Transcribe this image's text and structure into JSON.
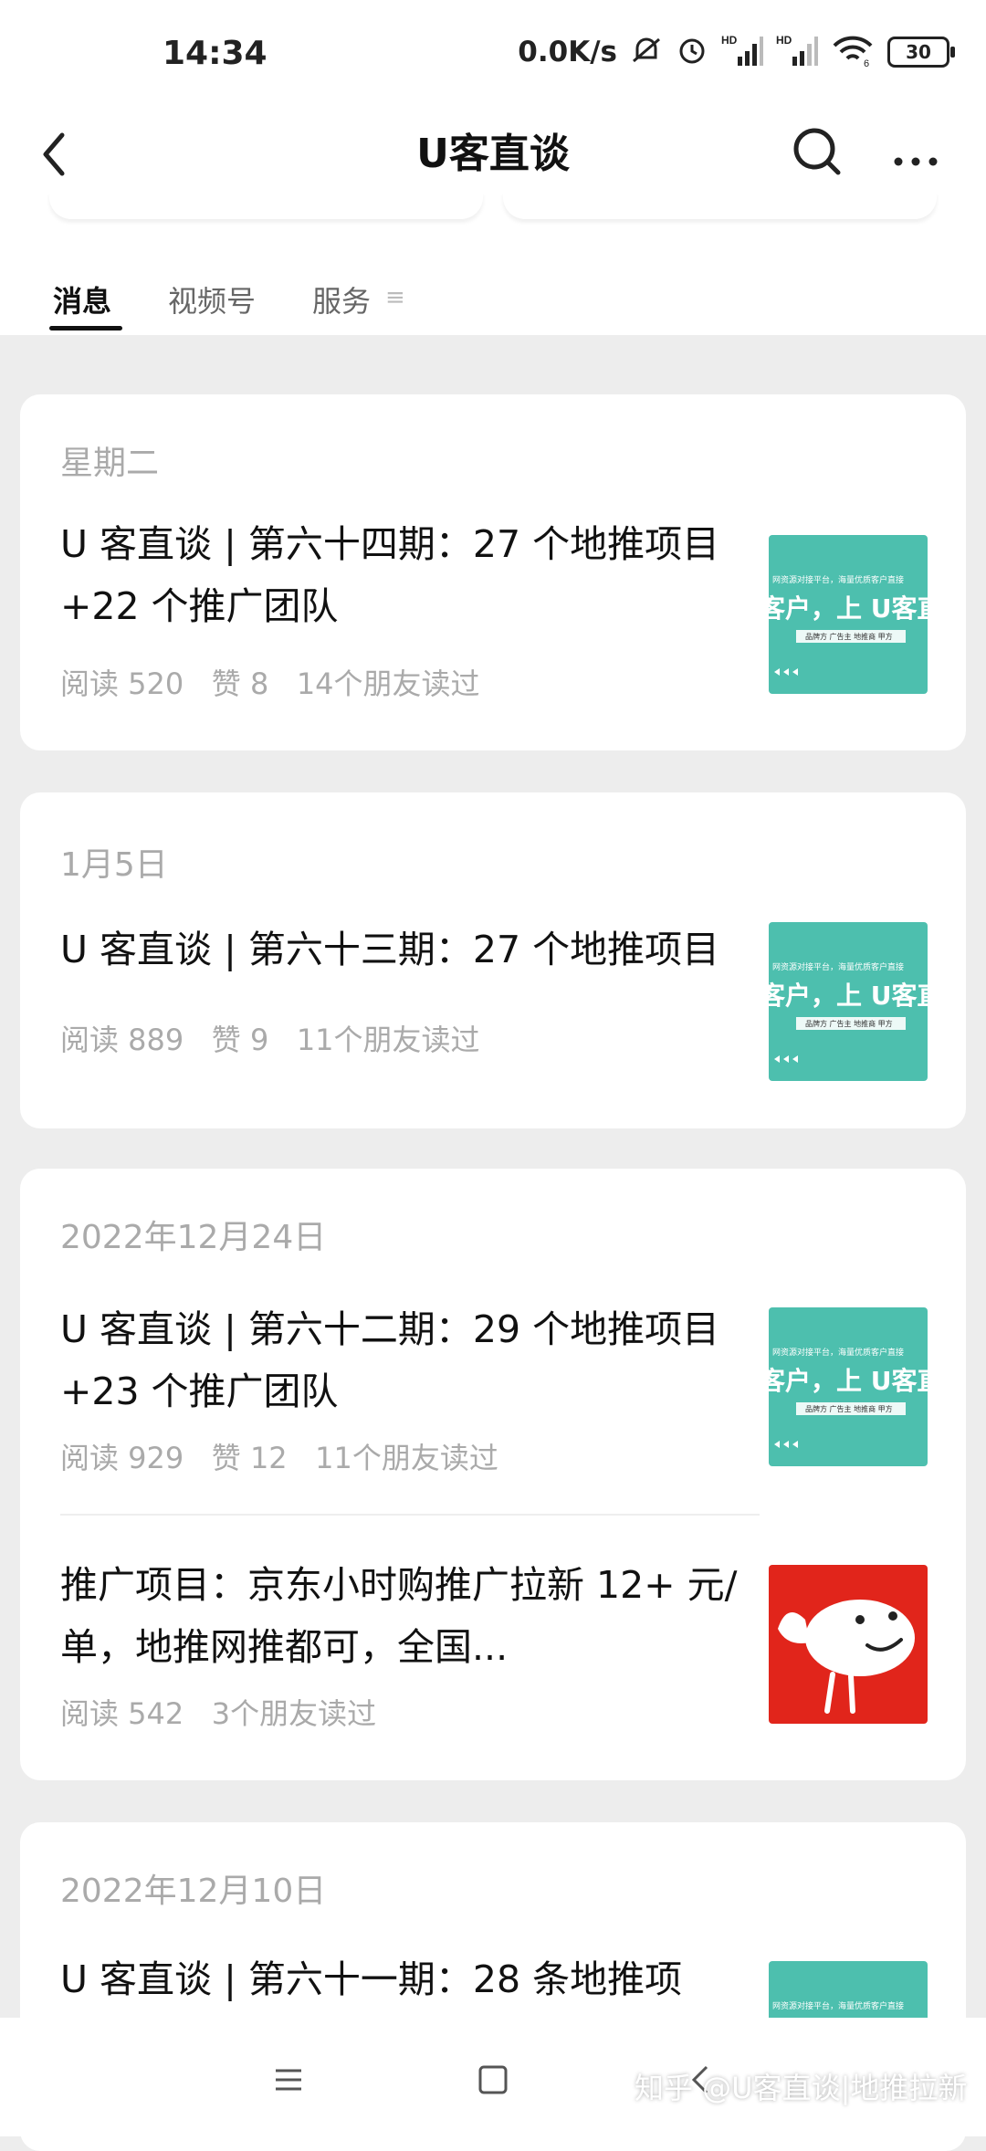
{
  "status": {
    "time": "14:34",
    "netspeed": "0.0K/s",
    "battery": "30",
    "hd1": "HD",
    "hd2": "HD",
    "wifi_sub": "6"
  },
  "nav": {
    "title": "U客直谈"
  },
  "tabs": [
    "消息",
    "视频号",
    "服务"
  ],
  "thumbs": {
    "banner_line": "网资源对接平台，海量优质客户直接",
    "banner_main": "客户，上 U客直",
    "banner_tags": "品牌方 广告主 地推商 甲方",
    "colors": {
      "teal": "#4dbfae",
      "red": "#e1251b"
    }
  },
  "cards": [
    {
      "date": "星期二",
      "articles": [
        {
          "title": "U 客直谈 | 第六十四期：27 个地推项目 +22 个推广团队",
          "meta": "阅读 520   赞 8   14个朋友读过"
        }
      ]
    },
    {
      "date": "1月5日",
      "articles": [
        {
          "title": "U 客直谈 | 第六十三期：27 个地推项目",
          "meta": "阅读 889   赞 9   11个朋友读过"
        }
      ]
    },
    {
      "date": "2022年12月24日",
      "articles": [
        {
          "title": "U 客直谈 | 第六十二期：29 个地推项目 +23 个推广团队",
          "meta": "阅读 929   赞 12   11个朋友读过"
        },
        {
          "title": "推广项目：京东小时购推广拉新 12+ 元/单，地推网推都可，全国...",
          "meta": "阅读 542   3个朋友读过"
        }
      ]
    },
    {
      "date": "2022年12月10日",
      "articles": [
        {
          "title": "U 客直谈 | 第六十一期：28 条地推项",
          "meta": ""
        }
      ]
    }
  ],
  "watermark": "知乎 @U客直谈|地推拉新"
}
